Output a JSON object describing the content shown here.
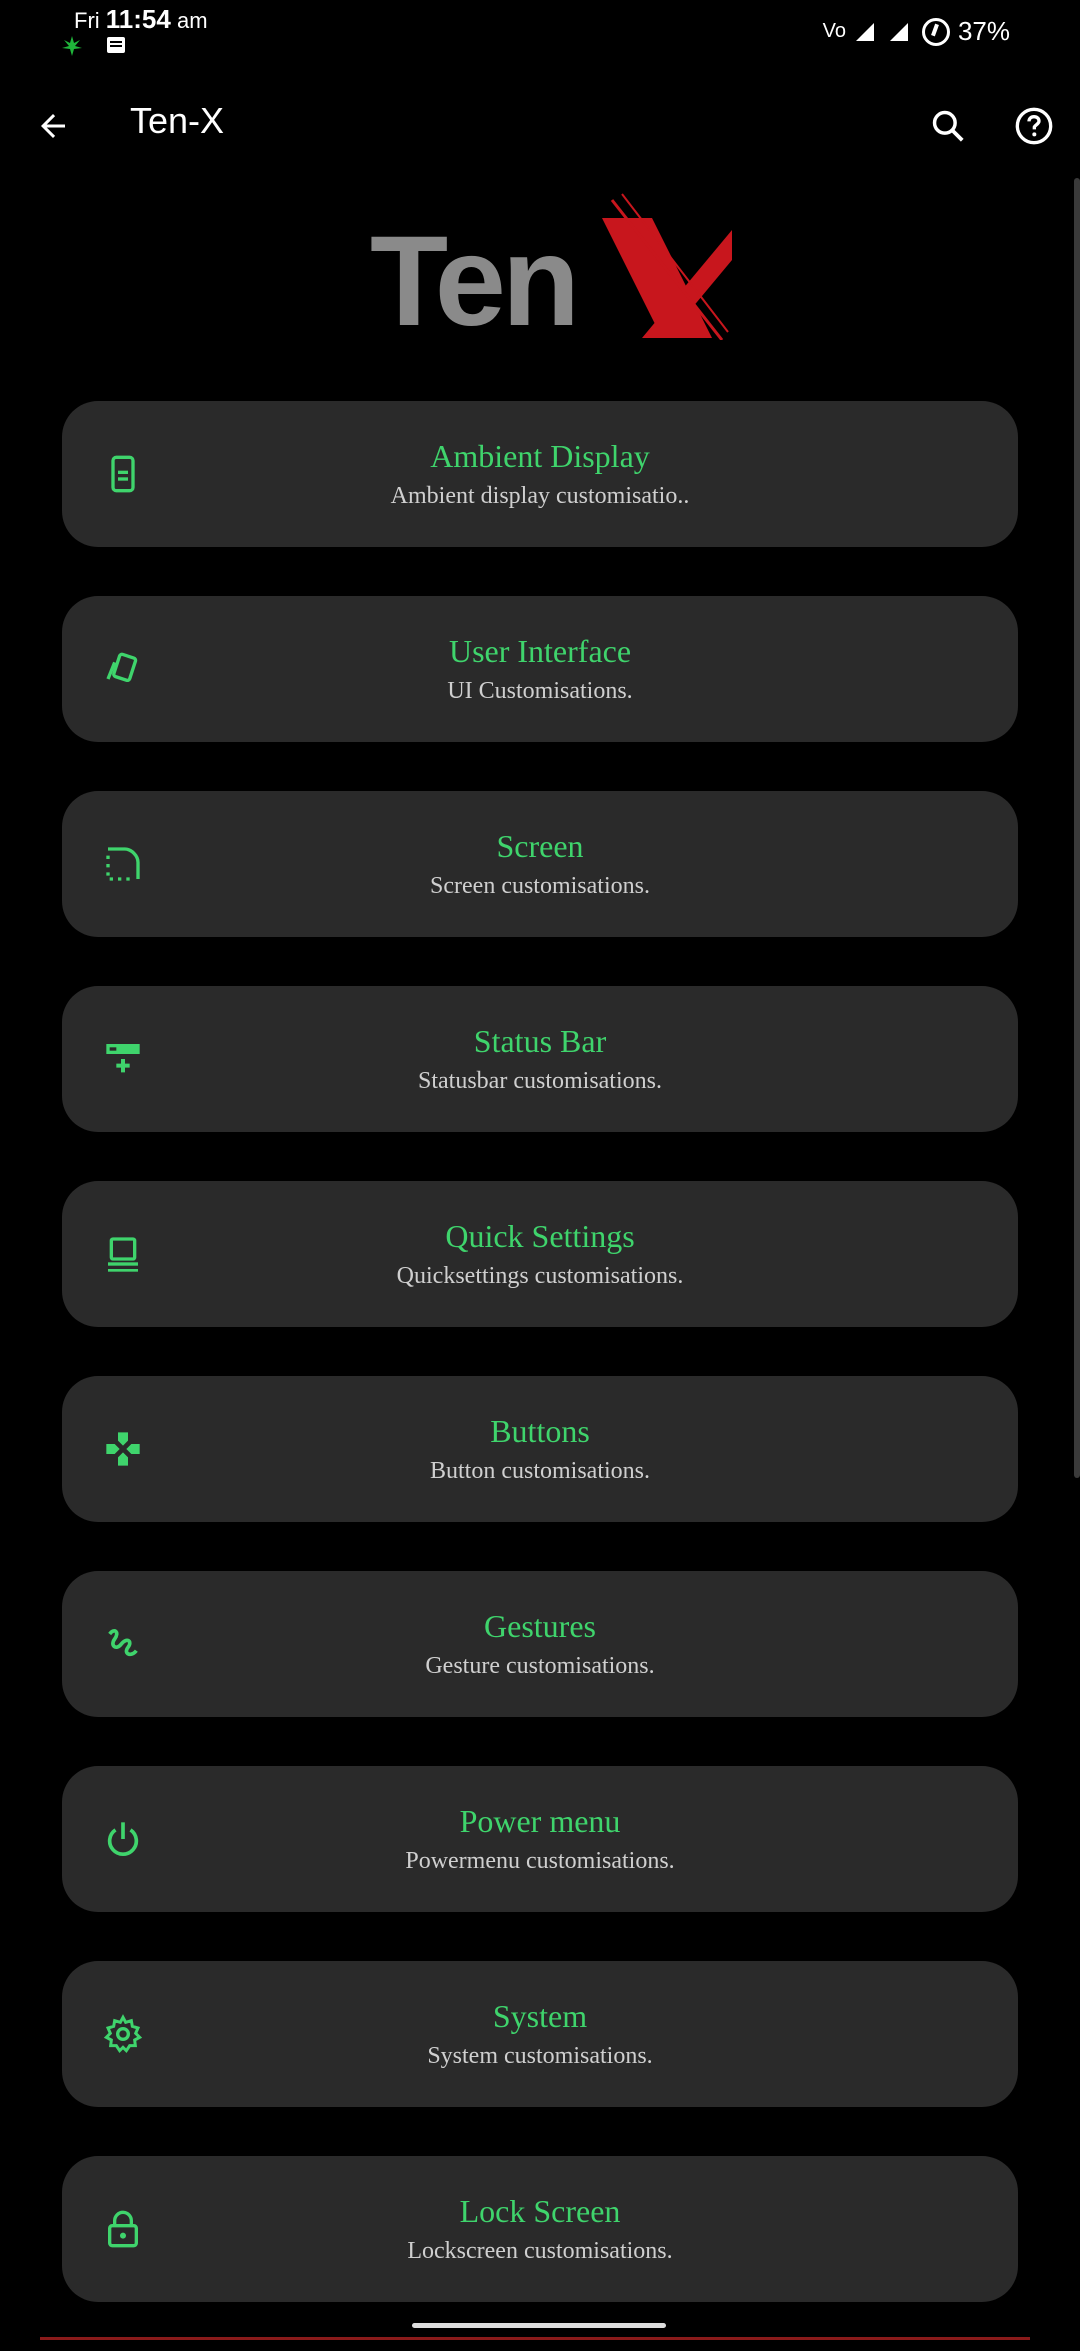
{
  "status_bar": {
    "day": "Fri",
    "time": "11:54",
    "ampm": "am",
    "network": "Vo",
    "battery": "37%"
  },
  "app_bar": {
    "title": "Ten-X"
  },
  "logo": {
    "text": "Ten",
    "accent_letter": "X"
  },
  "colors": {
    "accent": "#3fd46c",
    "card_bg": "#2a2a2a",
    "logo_gray": "#8a8a8a",
    "logo_red": "#c8161d"
  },
  "items": [
    {
      "title": "Ambient Display",
      "subtitle": "Ambient display customisatio..",
      "icon": "phone-icon"
    },
    {
      "title": "User Interface",
      "subtitle": "UI Customisations.",
      "icon": "cards-icon"
    },
    {
      "title": "Screen",
      "subtitle": "Screen customisations.",
      "icon": "screen-corner-icon"
    },
    {
      "title": "Status Bar",
      "subtitle": "Statusbar customisations.",
      "icon": "statusbar-add-icon"
    },
    {
      "title": "Quick Settings",
      "subtitle": "Quicksettings customisations.",
      "icon": "laptop-icon"
    },
    {
      "title": "Buttons",
      "subtitle": "Button customisations.",
      "icon": "gamepad-icon"
    },
    {
      "title": "Gestures",
      "subtitle": "Gesture customisations.",
      "icon": "gesture-icon"
    },
    {
      "title": "Power menu",
      "subtitle": "Powermenu customisations.",
      "icon": "power-icon"
    },
    {
      "title": "System",
      "subtitle": "System customisations.",
      "icon": "gear-icon"
    },
    {
      "title": "Lock Screen",
      "subtitle": "Lockscreen customisations.",
      "icon": "lock-icon"
    }
  ]
}
